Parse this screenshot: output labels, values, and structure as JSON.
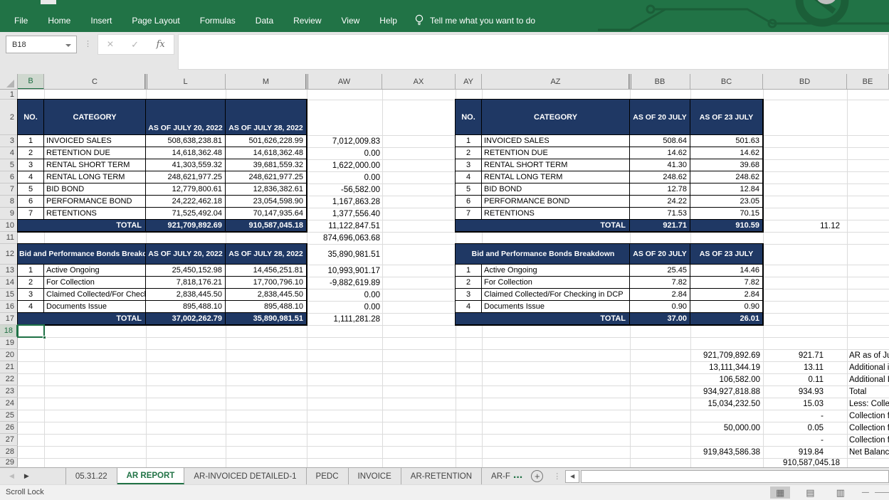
{
  "colors": {
    "ribbon_green": "#217346",
    "navy_header": "#1F3864",
    "selection_green": "#1E7145"
  },
  "chrome": {
    "ribbon_tabs": [
      "File",
      "Home",
      "Insert",
      "Page Layout",
      "Formulas",
      "Data",
      "Review",
      "View",
      "Help"
    ],
    "tell_me": "Tell me what you want to do",
    "name_box": "B18",
    "formula_value": "",
    "status_left": "Scroll Lock"
  },
  "icons": {
    "close": "×",
    "check": "✓",
    "fx": "fx",
    "nav_left": "◀",
    "nav_right": "▶",
    "scroll_left": "◀",
    "add_sheet": "+",
    "overflow_dots": "...",
    "more_dots": "⋮",
    "view_normal": "▦",
    "view_layout": "▤",
    "view_break": "▥",
    "zoom_minus": "—"
  },
  "grid": {
    "columns": [
      "B",
      "C",
      "L",
      "M",
      "AW",
      "AX",
      "AY",
      "AZ",
      "BB",
      "BC",
      "BD",
      "BE"
    ],
    "row_numbers": [
      1,
      2,
      3,
      4,
      5,
      6,
      7,
      8,
      9,
      10,
      11,
      12,
      13,
      14,
      15,
      16,
      17,
      18,
      19,
      20,
      21,
      22,
      23,
      24,
      25,
      26,
      27,
      28,
      29
    ],
    "selected_cell": "B18"
  },
  "left_table1": {
    "header": {
      "no": "NO.",
      "category": "CATEGORY",
      "c1": "AS OF JULY 20, 2022",
      "c2": "AS OF JULY 28, 2022"
    },
    "rows": [
      [
        "1",
        "INVOICED SALES",
        "508,638,238.81",
        "501,626,228.99"
      ],
      [
        "2",
        "RETENTION DUE",
        "14,618,362.48",
        "14,618,362.48"
      ],
      [
        "3",
        "RENTAL SHORT TERM",
        "41,303,559.32",
        "39,681,559.32"
      ],
      [
        "4",
        "RENTAL LONG TERM",
        "248,621,977.25",
        "248,621,977.25"
      ],
      [
        "5",
        "BID BOND",
        "12,779,800.61",
        "12,836,382.61"
      ],
      [
        "6",
        "PERFORMANCE BOND",
        "24,222,462.18",
        "23,054,598.90"
      ],
      [
        "7",
        "RETENTIONS",
        "71,525,492.04",
        "70,147,935.64"
      ]
    ],
    "total": [
      "TOTAL",
      "921,709,892.69",
      "910,587,045.18"
    ]
  },
  "left_table2": {
    "title": "Bid and Performance Bonds Breakdown",
    "header": {
      "c1": "AS OF JULY 20, 2022",
      "c2": "AS OF JULY 28, 2022"
    },
    "rows": [
      [
        "1",
        "Active Ongoing",
        "25,450,152.98",
        "14,456,251.81"
      ],
      [
        "2",
        "For Collection",
        "7,818,176.21",
        "17,700,796.10"
      ],
      [
        "3",
        "Claimed Collected/For Checking in DCP",
        "2,838,445.50",
        "2,838,445.50"
      ],
      [
        "4",
        "Documents Issue",
        "895,488.10",
        "895,488.10"
      ]
    ],
    "total": [
      "TOTAL",
      "37,002,262.79",
      "35,890,981.51"
    ]
  },
  "right_table1": {
    "header": {
      "no": "NO.",
      "category": "CATEGORY",
      "c1": "AS OF 20 JULY",
      "c2": "AS OF 23 JULY"
    },
    "rows": [
      [
        "1",
        "INVOICED SALES",
        "508.64",
        "501.63"
      ],
      [
        "2",
        "RETENTION DUE",
        "14.62",
        "14.62"
      ],
      [
        "3",
        "RENTAL SHORT TERM",
        "41.30",
        "39.68"
      ],
      [
        "4",
        "RENTAL LONG TERM",
        "248.62",
        "248.62"
      ],
      [
        "5",
        "BID BOND",
        "12.78",
        "12.84"
      ],
      [
        "6",
        "PERFORMANCE BOND",
        "24.22",
        "23.05"
      ],
      [
        "7",
        "RETENTIONS",
        "71.53",
        "70.15"
      ]
    ],
    "total": [
      "TOTAL",
      "921.71",
      "910.59"
    ]
  },
  "right_table2": {
    "title": "Bid and Performance Bonds Breakdown",
    "header": {
      "c1": "AS OF 20 JULY",
      "c2": "AS OF 23 JULY"
    },
    "rows": [
      [
        "1",
        "Active Ongoing",
        "25.45",
        "14.46"
      ],
      [
        "2",
        "For Collection",
        "7.82",
        "7.82"
      ],
      [
        "3",
        "Claimed Collected/For Checking in DCP",
        "2.84",
        "2.84"
      ],
      [
        "4",
        "Documents Issue",
        "0.90",
        "0.90"
      ]
    ],
    "total": [
      "TOTAL",
      "37.00",
      "26.01"
    ]
  },
  "aw_values": [
    [
      "3",
      "7,012,009.83"
    ],
    [
      "4",
      "0.00"
    ],
    [
      "5",
      "1,622,000.00"
    ],
    [
      "6",
      "0.00"
    ],
    [
      "7",
      "-56,582.00"
    ],
    [
      "8",
      "1,167,863.28"
    ],
    [
      "9",
      "1,377,556.40"
    ],
    [
      "10",
      "11,122,847.51"
    ],
    [
      "11",
      "874,696,063.68"
    ],
    [
      "12",
      "35,890,981.51"
    ],
    [
      "13",
      "10,993,901.17"
    ],
    [
      "14",
      "-9,882,619.89"
    ],
    [
      "15",
      "0.00"
    ],
    [
      "16",
      "0.00"
    ],
    [
      "17",
      "1,111,281.28"
    ]
  ],
  "bd_row10": "11.12",
  "summary_rows": [
    {
      "r": 20,
      "bc": "921,709,892.69",
      "bd": "921.71",
      "label": "AR as of Ju"
    },
    {
      "r": 21,
      "bc": "13,111,344.19",
      "bd": "13.11",
      "label": "Additional i"
    },
    {
      "r": 22,
      "bc": "106,582.00",
      "bd": "0.11",
      "label": "Additional I"
    },
    {
      "r": 23,
      "bc": "934,927,818.88",
      "bd": "934.93",
      "label": "Total"
    },
    {
      "r": 24,
      "bc": "15,034,232.50",
      "bd": "15.03",
      "label": "Less: Colle"
    },
    {
      "r": 25,
      "bc": "",
      "bd": "-",
      "label": "Collection f"
    },
    {
      "r": 26,
      "bc": "50,000.00",
      "bd": "0.05",
      "label": "Collection f"
    },
    {
      "r": 27,
      "bc": "",
      "bd": "-",
      "label": "Collection f"
    },
    {
      "r": 28,
      "bc": "919,843,586.38",
      "bd": "919.84",
      "label": "Net Balanc"
    },
    {
      "r": 29,
      "bc": "",
      "bd": "910,587,045.18",
      "label": ""
    }
  ],
  "sheet_tabs": {
    "tabs": [
      "05.31.22",
      "AR REPORT",
      "AR-INVOICED DETAILED-1",
      "PEDC",
      "INVOICE",
      "AR-RETENTION",
      "AR-F"
    ],
    "active": "AR REPORT"
  }
}
